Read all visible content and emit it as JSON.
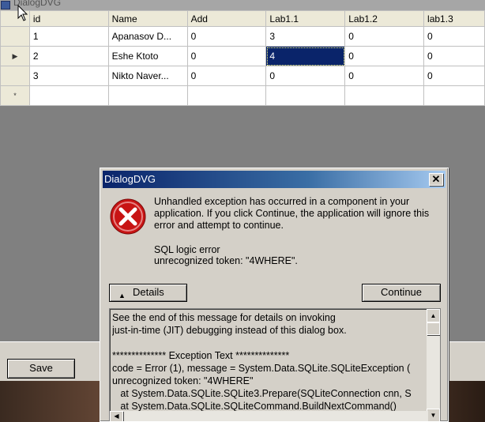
{
  "window": {
    "title": "DialogDVG"
  },
  "grid": {
    "columns": [
      "id",
      "Name",
      "Add",
      "Lab1.1",
      "Lab1.2",
      "lab1.3"
    ],
    "rows": [
      {
        "marker": "",
        "cells": [
          "1",
          "Apanasov D...",
          "0",
          "3",
          "0",
          "0"
        ]
      },
      {
        "marker": "▶",
        "cells": [
          "2",
          "Eshe Ktoto",
          "0",
          "4",
          "0",
          "0"
        ]
      },
      {
        "marker": "",
        "cells": [
          "3",
          "Nikto Naver...",
          "0",
          "0",
          "0",
          "0"
        ]
      },
      {
        "marker": "*",
        "cells": [
          "",
          "",
          "",
          "",
          "",
          ""
        ]
      }
    ]
  },
  "save_label": "Save",
  "dialog": {
    "title": "DialogDVG",
    "close": "✕",
    "message": "Unhandled exception has occurred in a component in your application. If you click Continue, the application will ignore this error and attempt to continue.",
    "error_line1": "SQL logic error",
    "error_line2": "unrecognized token: \"4WHERE\".",
    "details_label": "Details",
    "continue_label": "Continue",
    "details_text": "See the end of this message for details on invoking\njust-in-time (JIT) debugging instead of this dialog box.\n\n************** Exception Text **************\ncode = Error (1), message = System.Data.SQLite.SQLiteException (\nunrecognized token: \"4WHERE\"\n   at System.Data.SQLite.SQLite3.Prepare(SQLiteConnection cnn, S\n   at System.Data.SQLite.SQLiteCommand.BuildNextCommand()"
  },
  "colors": {
    "selection": "#0a246a",
    "titlebar": "#0a246a",
    "error_red": "#c81414"
  },
  "icons": {
    "error": "error-icon",
    "app": "app-icon",
    "cursor": "mouse-cursor-icon"
  }
}
